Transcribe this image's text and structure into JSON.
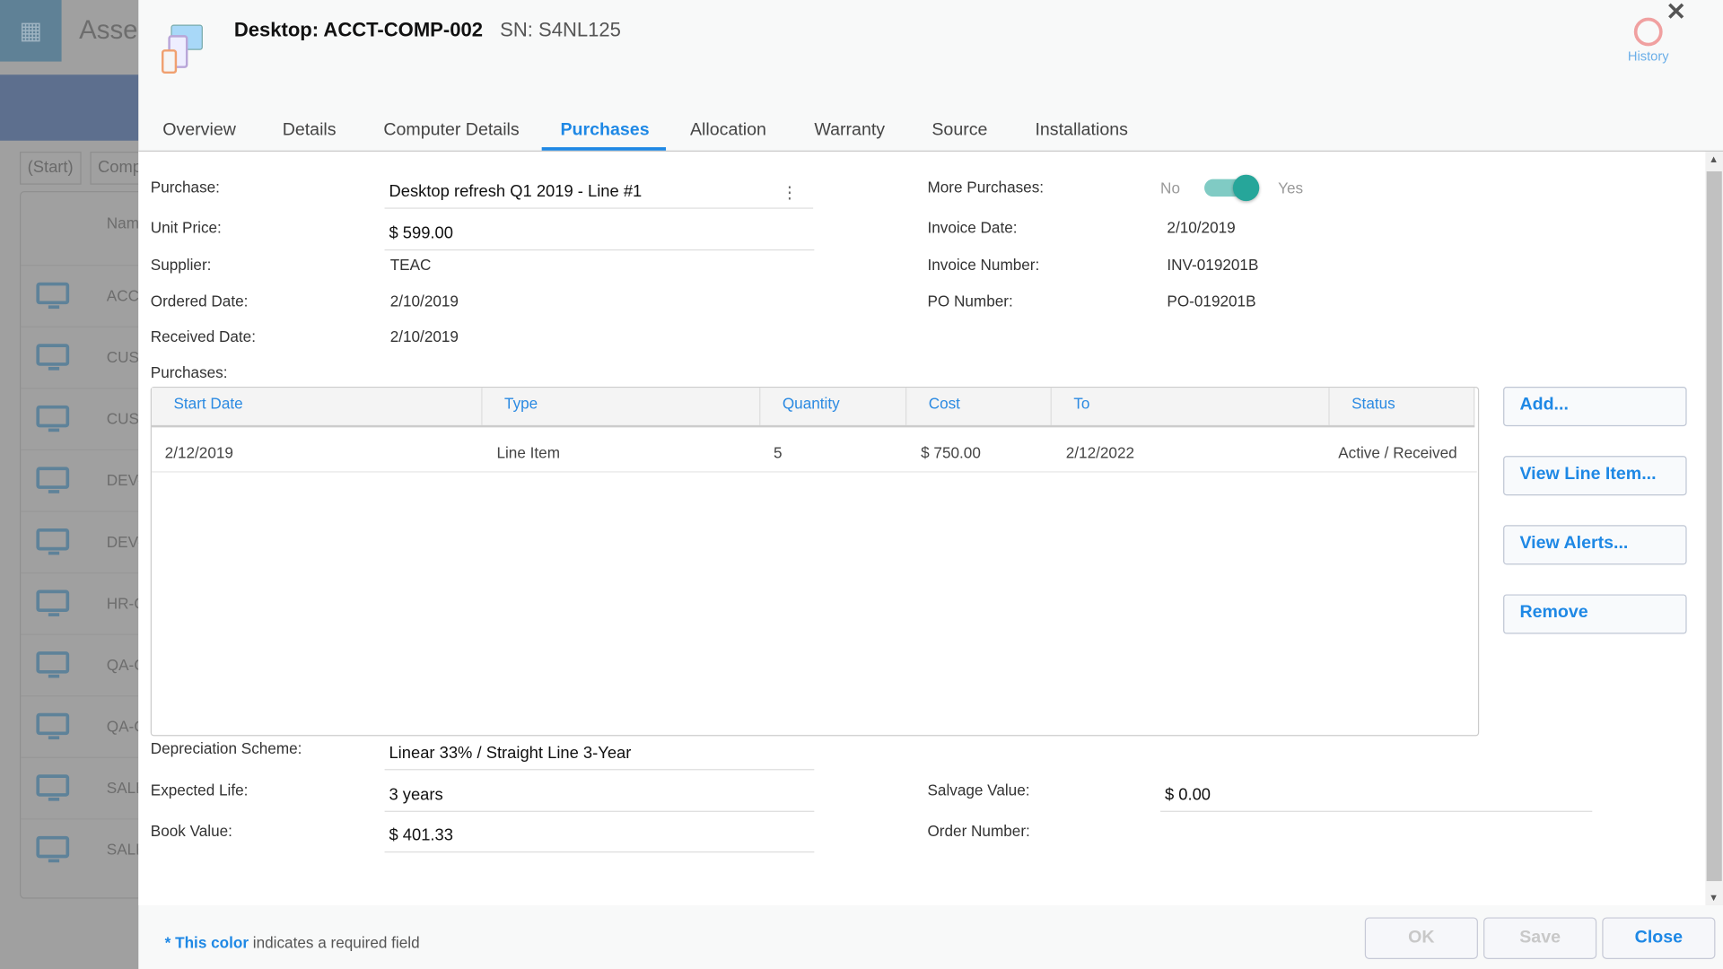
{
  "background": {
    "app_title": "Asse",
    "chips": [
      "(Start)",
      "Comp"
    ],
    "column_header": "Nam",
    "rows": [
      "ACCT",
      "CUST",
      "CUST",
      "DEV-",
      "DEV-",
      "HR-C",
      "QA-C",
      "QA-C",
      "SALE",
      "SALE"
    ]
  },
  "header": {
    "title": "Desktop: ACCT-COMP-002",
    "serial": "SN: S4NL125",
    "history_label": "History",
    "close_glyph": "✕"
  },
  "tabs": [
    {
      "label": "Overview"
    },
    {
      "label": "Details"
    },
    {
      "label": "Computer Details"
    },
    {
      "label": "Purchases",
      "active": true
    },
    {
      "label": "Allocation"
    },
    {
      "label": "Warranty"
    },
    {
      "label": "Source"
    },
    {
      "label": "Installations"
    }
  ],
  "form": {
    "purchase_label": "Purchase:",
    "purchase_value": "Desktop refresh Q1 2019 - Line #1",
    "unit_price_label": "Unit Price:",
    "unit_price_value": "$ 599.00",
    "supplier_label": "Supplier:",
    "supplier_value": "TEAC",
    "ordered_date_label": "Ordered Date:",
    "ordered_date_value": "2/10/2019",
    "received_date_label": "Received Date:",
    "received_date_value": "2/10/2019",
    "more_purchases_label": "More Purchases:",
    "toggle_no": "No",
    "toggle_yes": "Yes",
    "more_purchases_on": true,
    "invoice_date_label": "Invoice Date:",
    "invoice_date_value": "2/10/2019",
    "invoice_number_label": "Invoice Number:",
    "invoice_number_value": "INV-019201B",
    "po_number_label": "PO Number:",
    "po_number_value": "PO-019201B",
    "purchases_label": "Purchases:",
    "depreciation_label": "Depreciation Scheme:",
    "depreciation_value": "Linear 33% / Straight Line 3-Year",
    "expected_life_label": "Expected Life:",
    "expected_life_value": "3 years",
    "book_value_label": "Book Value:",
    "book_value_value": "$ 401.33",
    "salvage_label": "Salvage Value:",
    "salvage_value": "$ 0.00",
    "order_number_label": "Order Number:",
    "order_number_value": ""
  },
  "table": {
    "columns": [
      "Start Date",
      "Type",
      "Quantity",
      "Cost",
      "To",
      "Status"
    ],
    "rows": [
      {
        "start_date": "2/12/2019",
        "type": "Line Item",
        "quantity": "5",
        "cost": "$ 750.00",
        "to": "2/12/2022",
        "status": "Active / Received"
      }
    ]
  },
  "side_buttons": {
    "add": "Add...",
    "view_line_item": "View Line Item...",
    "view_alerts": "View Alerts...",
    "remove": "Remove"
  },
  "footer": {
    "required_marker": "* This color",
    "required_text": " indicates a required field",
    "ok": "OK",
    "save": "Save",
    "close": "Close"
  },
  "colors": {
    "accent": "#1e88e5",
    "toggle": "#26a69a"
  }
}
